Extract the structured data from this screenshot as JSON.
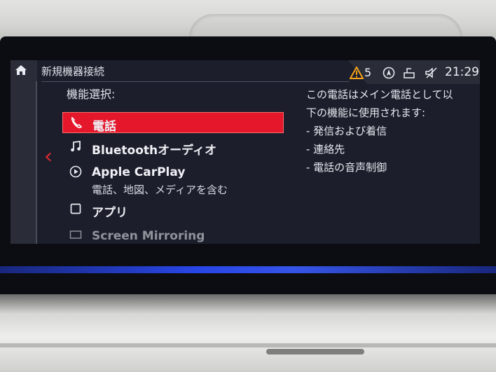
{
  "header": {
    "title": "新規機器接続",
    "warning_count": "5",
    "time": "21:29"
  },
  "section_label": "機能選択:",
  "menu": [
    {
      "label": "電話",
      "icon": "phone-icon",
      "selected": true
    },
    {
      "label": "Bluetoothオーディオ",
      "icon": "music-note-icon",
      "selected": false
    },
    {
      "label": "Apple CarPlay",
      "icon": "carplay-icon",
      "selected": false,
      "sublabel": "電話、地図、メディアを含む"
    },
    {
      "label": "アプリ",
      "icon": "apps-square-icon",
      "selected": false
    },
    {
      "label": "Screen Mirroring",
      "icon": "screen-mirroring-icon",
      "selected": false
    }
  ],
  "info": {
    "line1": "この電話はメイン電話として以",
    "line2": "下の機能に使用されます:",
    "bullets": [
      "- 発信および着信",
      "- 連絡先",
      "- 電話の音声制御"
    ]
  },
  "colors": {
    "accent": "#e4172b",
    "screen_bg": "#1c1f2b",
    "warning": "#f5a21a",
    "ambient_light": "#2c4cff"
  }
}
